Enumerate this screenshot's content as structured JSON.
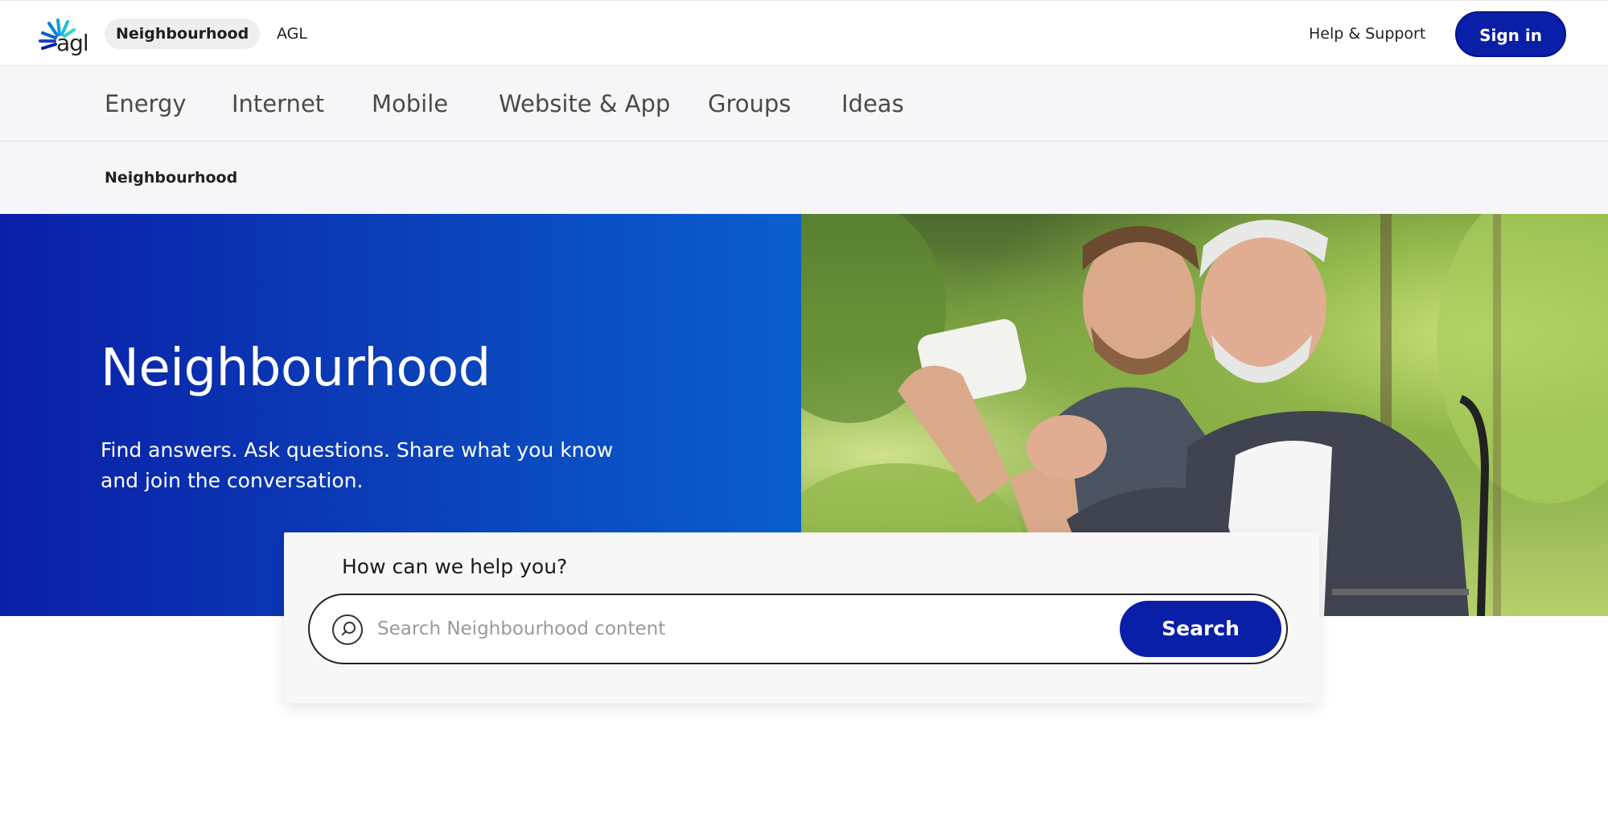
{
  "header": {
    "logo_text": "agl",
    "pill_label": "Neighbourhood",
    "agl_link": "AGL",
    "help_link": "Help & Support",
    "signin_label": "Sign in"
  },
  "nav": {
    "items": [
      {
        "label": "Energy"
      },
      {
        "label": "Internet"
      },
      {
        "label": "Mobile"
      },
      {
        "label": "Website & App"
      },
      {
        "label": "Groups"
      },
      {
        "label": "Ideas"
      }
    ]
  },
  "breadcrumb": {
    "current": "Neighbourhood"
  },
  "hero": {
    "title": "Neighbourhood",
    "subtitle": "Find answers. Ask questions. Share what you know and join the conversation."
  },
  "search": {
    "question": "How can we help you?",
    "placeholder": "Search Neighbourhood content",
    "value": "",
    "button_label": "Search"
  },
  "colors": {
    "brand_blue": "#0a1fa8",
    "nav_bg": "#f6f6f8"
  }
}
